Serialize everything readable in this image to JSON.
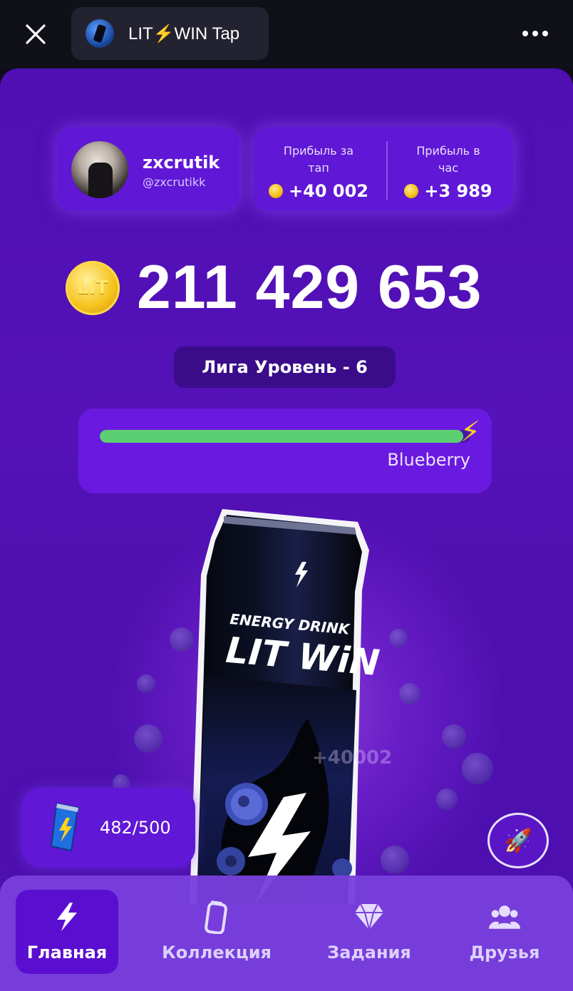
{
  "topbar": {
    "title": "LIT⚡WIN Tap"
  },
  "profile": {
    "name": "zxcrutik",
    "handle": "@zxcrutikk"
  },
  "stats": {
    "per_tap_label": "Прибыль за тап",
    "per_tap_value": "+40 002",
    "per_hour_label": "Прибыль в час",
    "per_hour_value": "+3 989"
  },
  "balance": {
    "coin_label": "LIT",
    "amount": "211 429 653"
  },
  "league": {
    "label": "Лига Уровень - 6",
    "name": "Blueberry",
    "progress_fraction": 0.98
  },
  "can": {
    "brand_top": "ENERGY DRINK",
    "brand": "LIT WiN"
  },
  "tap_popup": "+40002",
  "energy": {
    "value": "482/500"
  },
  "nav": {
    "items": [
      {
        "label": "Главная",
        "icon": "bolt-icon",
        "active": true
      },
      {
        "label": "Коллекция",
        "icon": "can-icon",
        "active": false
      },
      {
        "label": "Задания",
        "icon": "diamond-icon",
        "active": false
      },
      {
        "label": "Друзья",
        "icon": "friends-icon",
        "active": false
      }
    ]
  },
  "colors": {
    "app_bg": "#5412b8",
    "card_bg": "#6018d6",
    "progress_fill": "#5ccf73",
    "coin": "#f4c21c"
  }
}
